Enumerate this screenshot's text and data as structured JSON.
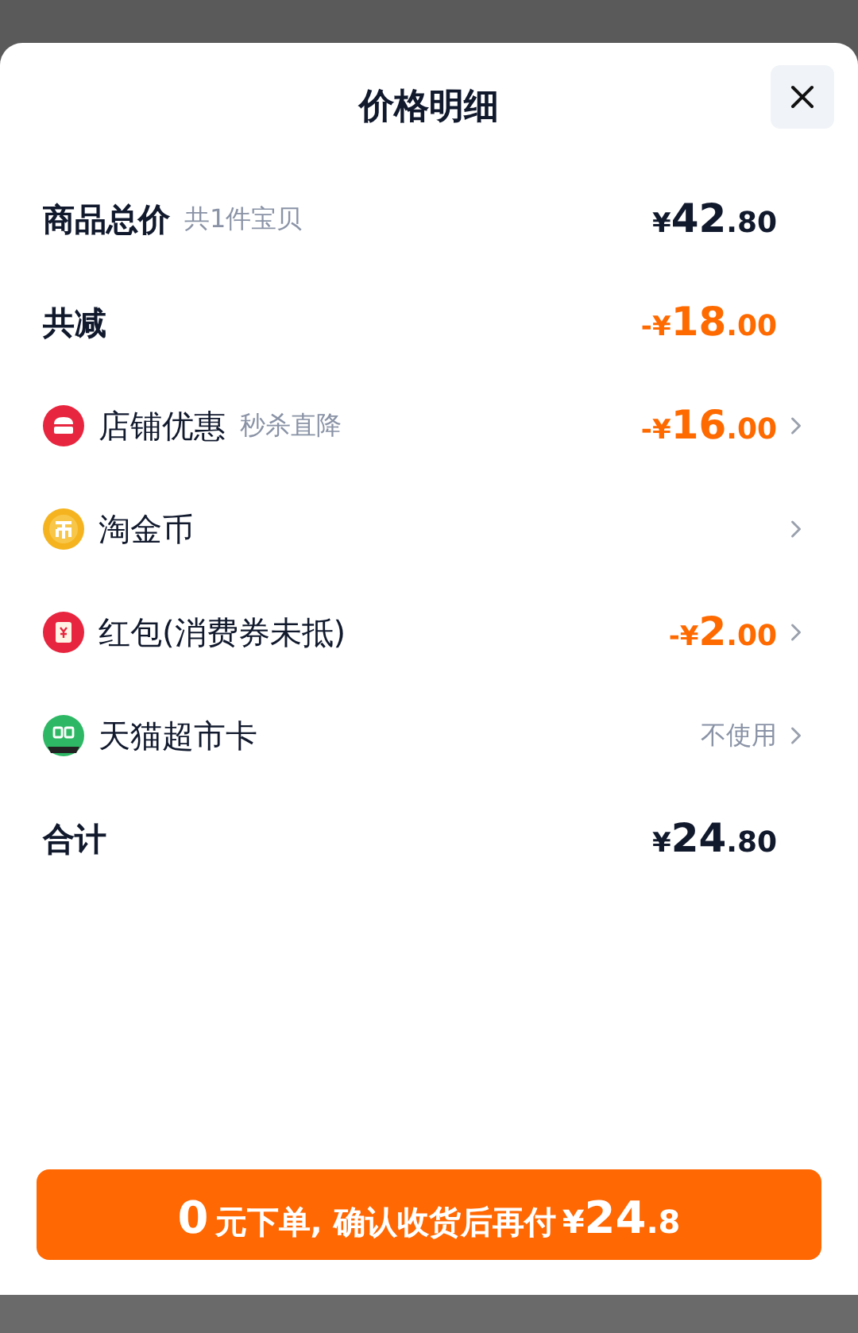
{
  "sheet": {
    "title": "价格明细"
  },
  "rows": [
    {
      "kind": "summary",
      "label": "商品总价",
      "note": "共1件宝贝",
      "price": {
        "prefix": "¥",
        "main": "42",
        "cents": ".80"
      },
      "highlight": false
    },
    {
      "kind": "summary",
      "label": "共减",
      "price": {
        "prefix": "-¥",
        "main": "18",
        "cents": ".00"
      },
      "highlight": true
    },
    {
      "kind": "discount",
      "label": "店铺优惠",
      "note": "秒杀直降",
      "price": {
        "prefix": "-¥",
        "main": "16",
        "cents": ".00"
      },
      "highlight": true
    },
    {
      "kind": "discount",
      "label": "淘金币"
    },
    {
      "kind": "discount",
      "label": "红包(消费券未抵)",
      "price": {
        "prefix": "-¥",
        "main": "2",
        "cents": ".00"
      },
      "highlight": true
    },
    {
      "kind": "discount",
      "label": "天猫超市卡",
      "status": "不使用"
    },
    {
      "kind": "summary",
      "label": "合计",
      "price": {
        "prefix": "¥",
        "main": "24",
        "cents": ".80"
      },
      "highlight": false
    }
  ],
  "pay_button": {
    "lead": "0",
    "text": "元下单, 确认收货后再付",
    "currency": "¥",
    "main": "24",
    "cents": ".8"
  }
}
